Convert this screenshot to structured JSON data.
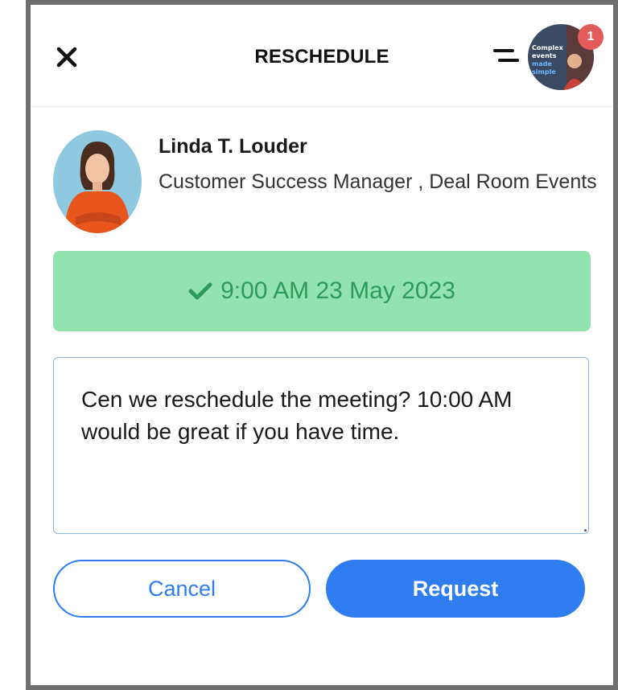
{
  "header": {
    "title": "RESCHEDULE",
    "notification_count": "1",
    "avatar_caption": [
      "Complex",
      "events",
      "made",
      "simple"
    ]
  },
  "profile": {
    "name": "Linda T. Louder",
    "role": "Customer Success Manager , Deal Room Events"
  },
  "slot": {
    "text": "9:00 AM 23 May 2023"
  },
  "message": {
    "text": "Cen we reschedule the meeting? 10:00 AM would be great if you have time."
  },
  "actions": {
    "cancel_label": "Cancel",
    "request_label": "Request"
  },
  "colors": {
    "accent": "#2f7df0",
    "slot_bg": "#92e3b0",
    "slot_text": "#2e9a58",
    "badge": "#e25c5c"
  },
  "icons": {
    "close": "close-icon",
    "menu": "menu-icon",
    "check": "check-icon"
  }
}
